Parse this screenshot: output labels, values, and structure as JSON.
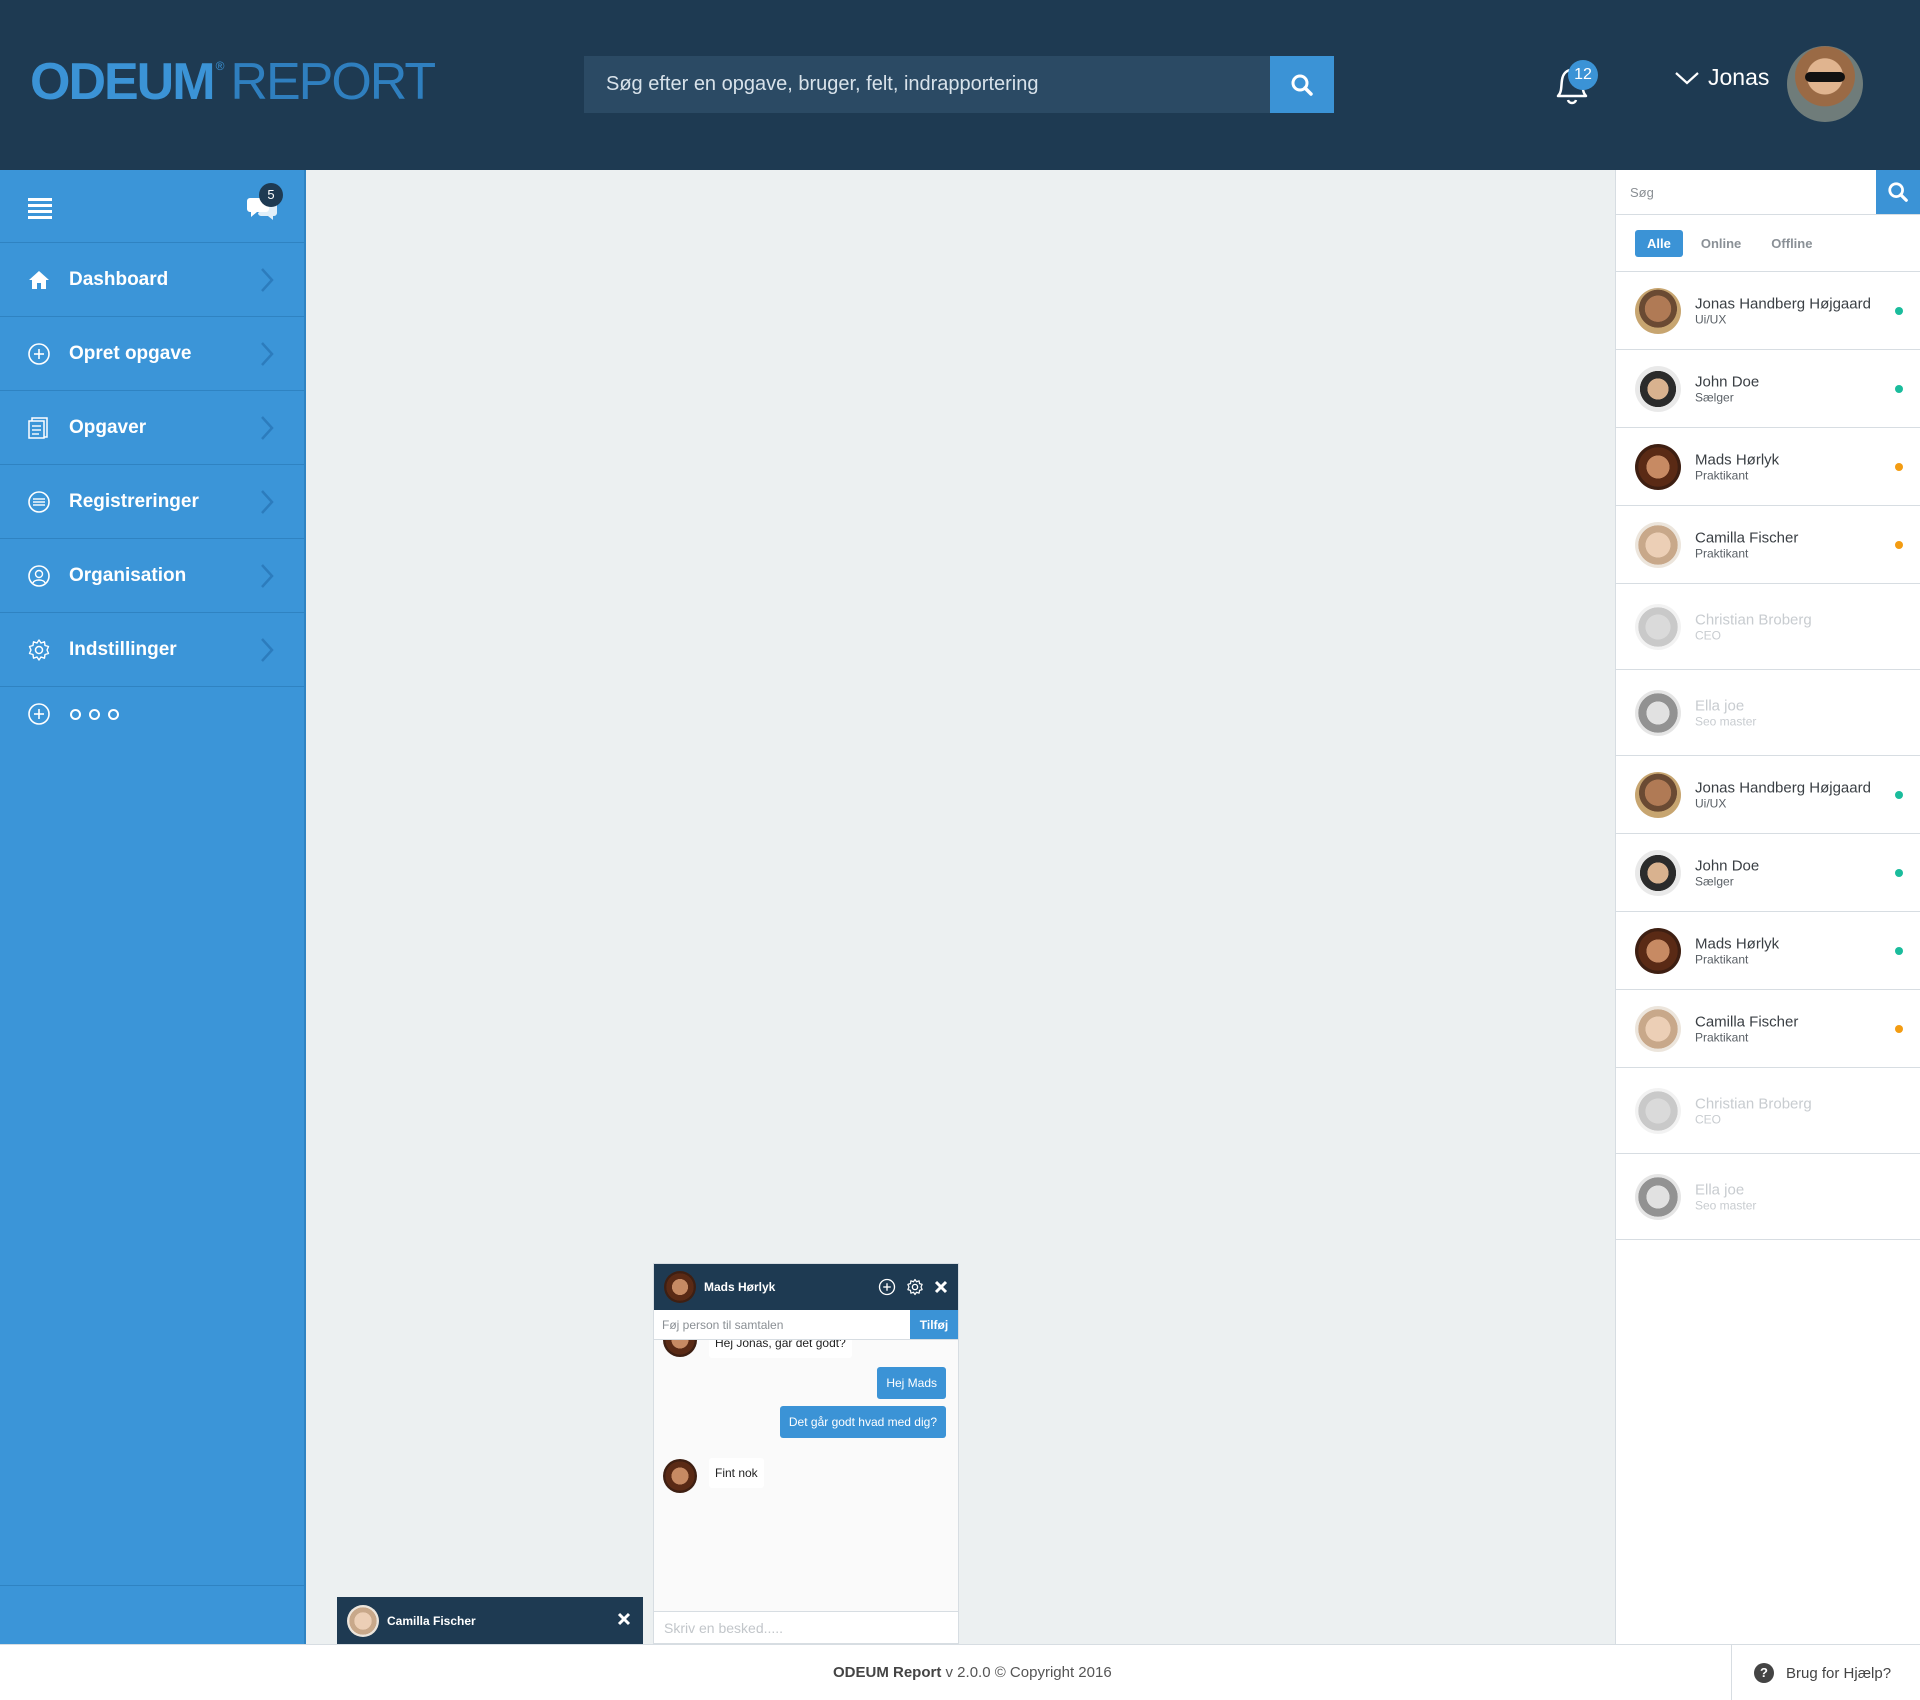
{
  "header": {
    "logo_primary": "ODEUM",
    "logo_registered": "®",
    "logo_secondary": "REPORT",
    "search_placeholder": "Søg efter en opgave, bruger, felt, indrapportering",
    "notifications_count": "12",
    "user_name": "Jonas"
  },
  "sidebar": {
    "chat_badge": "5",
    "items": [
      {
        "label": "Dashboard",
        "icon": "home-icon"
      },
      {
        "label": "Opret opgave",
        "icon": "plus-circle-icon"
      },
      {
        "label": "Opgaver",
        "icon": "tasks-icon"
      },
      {
        "label": "Registreringer",
        "icon": "list-circle-icon"
      },
      {
        "label": "Organisation",
        "icon": "user-circle-icon"
      },
      {
        "label": "Indstillinger",
        "icon": "gear-icon"
      }
    ]
  },
  "contacts_panel": {
    "search_placeholder": "Søg",
    "filters": [
      "Alle",
      "Online",
      "Offline"
    ],
    "active_filter": "Alle",
    "contacts": [
      {
        "name": "Jonas Handberg Højgaard",
        "role": "Ui/UX",
        "status": "online"
      },
      {
        "name": "John Doe",
        "role": "Sælger",
        "status": "online"
      },
      {
        "name": "Mads Hørlyk",
        "role": "Praktikant",
        "status": "away"
      },
      {
        "name": "Camilla Fischer",
        "role": "Praktikant",
        "status": "away"
      },
      {
        "name": "Christian Broberg",
        "role": "CEO",
        "status": "offline"
      },
      {
        "name": "Ella joe",
        "role": "Seo master",
        "status": "offline"
      },
      {
        "name": "Jonas Handberg Højgaard",
        "role": "Ui/UX",
        "status": "online"
      },
      {
        "name": "John Doe",
        "role": "Sælger",
        "status": "online"
      },
      {
        "name": "Mads Hørlyk",
        "role": "Praktikant",
        "status": "online"
      },
      {
        "name": "Camilla Fischer",
        "role": "Praktikant",
        "status": "away"
      },
      {
        "name": "Christian Broberg",
        "role": "CEO",
        "status": "offline"
      },
      {
        "name": "Ella joe",
        "role": "Seo master",
        "status": "offline"
      }
    ],
    "status_colors": {
      "online": "#1abc9c",
      "away": "#f39c12",
      "offline": "transparent"
    }
  },
  "chat_window": {
    "title": "Mads Hørlyk",
    "add_placeholder": "Føj person til samtalen",
    "add_button": "Tilføj",
    "messages": [
      {
        "from": "them",
        "text": "Hej Jonas, går det godt?"
      },
      {
        "from": "me",
        "text": "Hej Mads"
      },
      {
        "from": "me",
        "text": "Det går godt hvad med dig?"
      },
      {
        "from": "them",
        "text": "Fint nok"
      }
    ],
    "message_placeholder": "Skriv en besked....."
  },
  "chat_minimized": {
    "title": "Camilla Fischer"
  },
  "footer": {
    "brand": "ODEUM Report",
    "version_text": " v 2.0.0 © Copyright 2016",
    "help_icon": "?",
    "help_label": "Brug for Hjælp?"
  },
  "colors": {
    "header_bg": "#1e3a52",
    "accent": "#3b93d6",
    "sidebar_bg": "#3b95d8"
  }
}
